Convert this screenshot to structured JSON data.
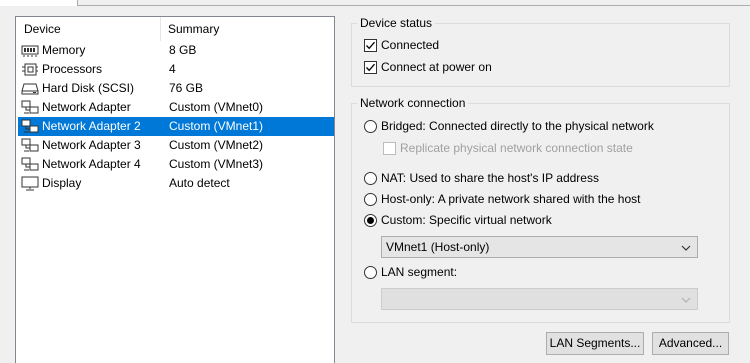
{
  "device_list": {
    "columns": {
      "device": "Device",
      "summary": "Summary"
    },
    "rows": [
      {
        "icon": "memory-icon",
        "name": "Memory",
        "summary": "8 GB"
      },
      {
        "icon": "processor-icon",
        "name": "Processors",
        "summary": "4"
      },
      {
        "icon": "hard-disk-icon",
        "name": "Hard Disk (SCSI)",
        "summary": "76 GB"
      },
      {
        "icon": "network-adapter-icon",
        "name": "Network Adapter",
        "summary": "Custom (VMnet0)"
      },
      {
        "icon": "network-adapter-icon",
        "name": "Network Adapter 2",
        "summary": "Custom (VMnet1)",
        "selected": true
      },
      {
        "icon": "network-adapter-icon",
        "name": "Network Adapter 3",
        "summary": "Custom (VMnet2)"
      },
      {
        "icon": "network-adapter-icon",
        "name": "Network Adapter 4",
        "summary": "Custom (VMnet3)"
      },
      {
        "icon": "display-icon",
        "name": "Display",
        "summary": "Auto detect"
      }
    ]
  },
  "device_status": {
    "title": "Device status",
    "connected": {
      "label": "Connected",
      "checked": true
    },
    "connect_at_power_on": {
      "label": "Connect at power on",
      "checked": true
    }
  },
  "network_connection": {
    "title": "Network connection",
    "bridged": {
      "label": "Bridged: Connected directly to the physical network",
      "selected": false
    },
    "replicate": {
      "label": "Replicate physical network connection state",
      "checked": false,
      "enabled": false
    },
    "nat": {
      "label": "NAT: Used to share the host's IP address",
      "selected": false
    },
    "host_only": {
      "label": "Host-only: A private network shared with the host",
      "selected": false
    },
    "custom": {
      "label": "Custom: Specific virtual network",
      "selected": true
    },
    "custom_network_value": "VMnet1 (Host-only)",
    "lan_segment": {
      "label": "LAN segment:",
      "selected": false
    },
    "lan_segment_value": ""
  },
  "buttons": {
    "lan_segments": "LAN Segments...",
    "advanced": "Advanced..."
  },
  "colors": {
    "selection": "#0078d7",
    "window_bg": "#f0f0f0"
  }
}
